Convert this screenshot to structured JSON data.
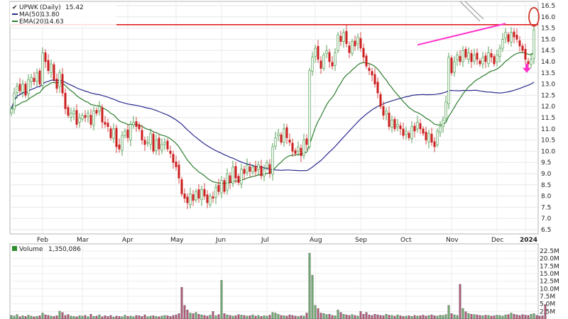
{
  "chart_data": [
    {
      "type": "candlestick",
      "symbol": "UPWK",
      "interval": "(Daily)",
      "last_price": "15.42",
      "legend": [
        {
          "label": "MA(50)",
          "value": "13.80",
          "color": "#2a2a8c"
        },
        {
          "label": "EMA(20)",
          "value": "14.63",
          "color": "#2e7d2e"
        }
      ],
      "ylim": [
        6.5,
        16.5
      ],
      "y_ticks": [
        "6.5",
        "7.0",
        "7.5",
        "8.0",
        "8.5",
        "9.0",
        "9.5",
        "10.0",
        "10.5",
        "11.0",
        "11.5",
        "12.0",
        "12.5",
        "13.0",
        "13.5",
        "14.0",
        "14.5",
        "15.0",
        "15.5",
        "16.0",
        "16.5"
      ],
      "month_labels": [
        "Feb",
        "Mar",
        "Apr",
        "May",
        "Jun",
        "Jul",
        "Aug",
        "Sep",
        "Oct",
        "Nov",
        "Dec",
        "2024"
      ],
      "resistance_level": 15.65,
      "trend_line": [
        [
          14.75,
          15.7
        ],
        [
          15.7,
          16.0
        ]
      ],
      "colors": {
        "up": "#2e8b2e",
        "down": "#cc1f1f",
        "ma50": "#2a2a8c",
        "ema20": "#2e7d2e",
        "resistance": "#e02020",
        "trendline": "#ff33cc",
        "arrow": "#ff33cc",
        "circle": "#d0392b"
      },
      "closes": [
        11.9,
        12.6,
        12.9,
        12.7,
        13.0,
        12.5,
        13.2,
        13.3,
        13.1,
        13.5,
        13.0,
        14.4,
        14.0,
        13.6,
        13.9,
        13.2,
        12.8,
        13.5,
        12.6,
        11.9,
        11.6,
        11.7,
        11.8,
        11.2,
        11.5,
        11.6,
        11.5,
        11.7,
        11.2,
        11.8,
        11.7,
        12.0,
        11.3,
        11.2,
        11.1,
        10.6,
        11.0,
        10.2,
        10.1,
        10.7,
        10.9,
        10.6,
        11.2,
        11.3,
        11.1,
        11.0,
        10.5,
        10.3,
        10.4,
        10.8,
        10.0,
        10.5,
        10.1,
        10.3,
        10.4,
        10.1,
        9.9,
        9.5,
        9.3,
        8.8,
        8.1,
        7.9,
        7.7,
        8.1,
        7.8,
        8.2,
        7.9,
        8.3,
        8.0,
        7.7,
        8.0,
        7.9,
        8.4,
        8.2,
        8.7,
        8.2,
        9.0,
        8.6,
        9.3,
        8.8,
        8.6,
        9.2,
        9.0,
        9.4,
        9.1,
        9.3,
        9.1,
        9.4,
        8.9,
        9.2,
        9.5,
        9.0,
        10.2,
        10.6,
        10.8,
        10.4,
        11.0,
        10.6,
        10.4,
        10.0,
        9.9,
        10.2,
        9.8,
        10.5,
        10.3,
        13.6,
        14.2,
        14.6,
        14.1,
        13.7,
        14.3,
        14.5,
        14.0,
        13.8,
        14.4,
        15.2,
        14.9,
        15.3,
        14.8,
        14.4,
        14.9,
        14.7,
        15.1,
        14.6,
        14.2,
        13.8,
        13.6,
        13.4,
        13.0,
        12.6,
        12.0,
        11.6,
        11.8,
        11.1,
        11.4,
        11.0,
        11.2,
        11.0,
        10.7,
        10.9,
        10.6,
        11.1,
        10.9,
        11.3,
        11.0,
        10.8,
        10.5,
        10.8,
        10.4,
        10.2,
        10.9,
        11.1,
        11.4,
        12.2,
        14.2,
        13.5,
        14.0,
        14.3,
        14.0,
        14.5,
        14.2,
        14.4,
        14.0,
        14.3,
        14.1,
        13.9,
        14.2,
        14.0,
        14.4,
        14.2,
        13.9,
        14.3,
        14.6,
        15.0,
        15.3,
        14.9,
        15.3,
        15.1,
        15.0,
        14.7,
        14.5,
        14.1,
        13.9,
        14.1,
        15.42
      ],
      "volume": {
        "label": "Volume",
        "value": "1,350,086",
        "ylim": [
          0,
          22.5
        ],
        "y_ticks": [
          "2.5M",
          "5.0M",
          "7.5M",
          "10.0M",
          "12.5M",
          "15.0M",
          "17.5M",
          "20.0M",
          "22.5M"
        ],
        "values": [
          1.2,
          1.0,
          1.5,
          0.8,
          1.1,
          0.9,
          1.3,
          1.0,
          0.8,
          0.9,
          1.1,
          2.0,
          1.4,
          1.2,
          1.0,
          0.9,
          1.1,
          2.6,
          2.2,
          1.2,
          1.5,
          1.0,
          0.9,
          0.8,
          1.1,
          1.0,
          1.2,
          0.8,
          1.6,
          0.9,
          1.0,
          1.4,
          0.8,
          1.1,
          0.9,
          1.2,
          0.7,
          1.0,
          0.9,
          0.8,
          1.3,
          0.9,
          1.0,
          0.8,
          1.2,
          1.1,
          0.9,
          1.4,
          0.8,
          1.0,
          1.1,
          0.9,
          0.8,
          1.0,
          1.2,
          1.1,
          0.9,
          1.2,
          1.4,
          1.8,
          10.5,
          4.5,
          3.0,
          2.0,
          1.8,
          2.2,
          1.6,
          1.4,
          1.2,
          1.0,
          1.3,
          2.5,
          1.1,
          1.5,
          12.8,
          1.8,
          1.4,
          1.2,
          1.0,
          1.1,
          1.5,
          1.3,
          1.2,
          1.0,
          1.1,
          1.4,
          1.0,
          1.2,
          0.9,
          1.1,
          1.0,
          1.3,
          2.2,
          2.0,
          1.6,
          1.2,
          1.1,
          1.0,
          1.4,
          1.2,
          1.0,
          0.9,
          1.1,
          1.0,
          2.0,
          21.8,
          14.5,
          4.5,
          3.5,
          2.0,
          1.8,
          1.5,
          1.6,
          1.2,
          1.1,
          3.0,
          2.2,
          1.6,
          1.4,
          1.2,
          1.5,
          1.2,
          1.0,
          2.5,
          1.6,
          2.2,
          1.4,
          1.2,
          1.6,
          1.4,
          1.2,
          1.1,
          1.6,
          1.3,
          1.2,
          1.0,
          1.4,
          1.1,
          0.9,
          1.0,
          1.1,
          0.9,
          1.2,
          1.0,
          1.1,
          1.3,
          1.0,
          1.2,
          1.4,
          1.1,
          1.0,
          1.3,
          1.2,
          1.5,
          4.5,
          1.8,
          1.4,
          1.2,
          11.5,
          3.5,
          2.4,
          1.8,
          1.6,
          1.5,
          1.4,
          1.2,
          1.1,
          1.3,
          1.2,
          1.0,
          1.1,
          1.3,
          1.2,
          1.0,
          1.4,
          1.5,
          2.0,
          1.6,
          1.4,
          1.2,
          1.5,
          1.3,
          1.2,
          1.6,
          1.8,
          1.2,
          1.0,
          1.1,
          4.8
        ]
      }
    }
  ]
}
